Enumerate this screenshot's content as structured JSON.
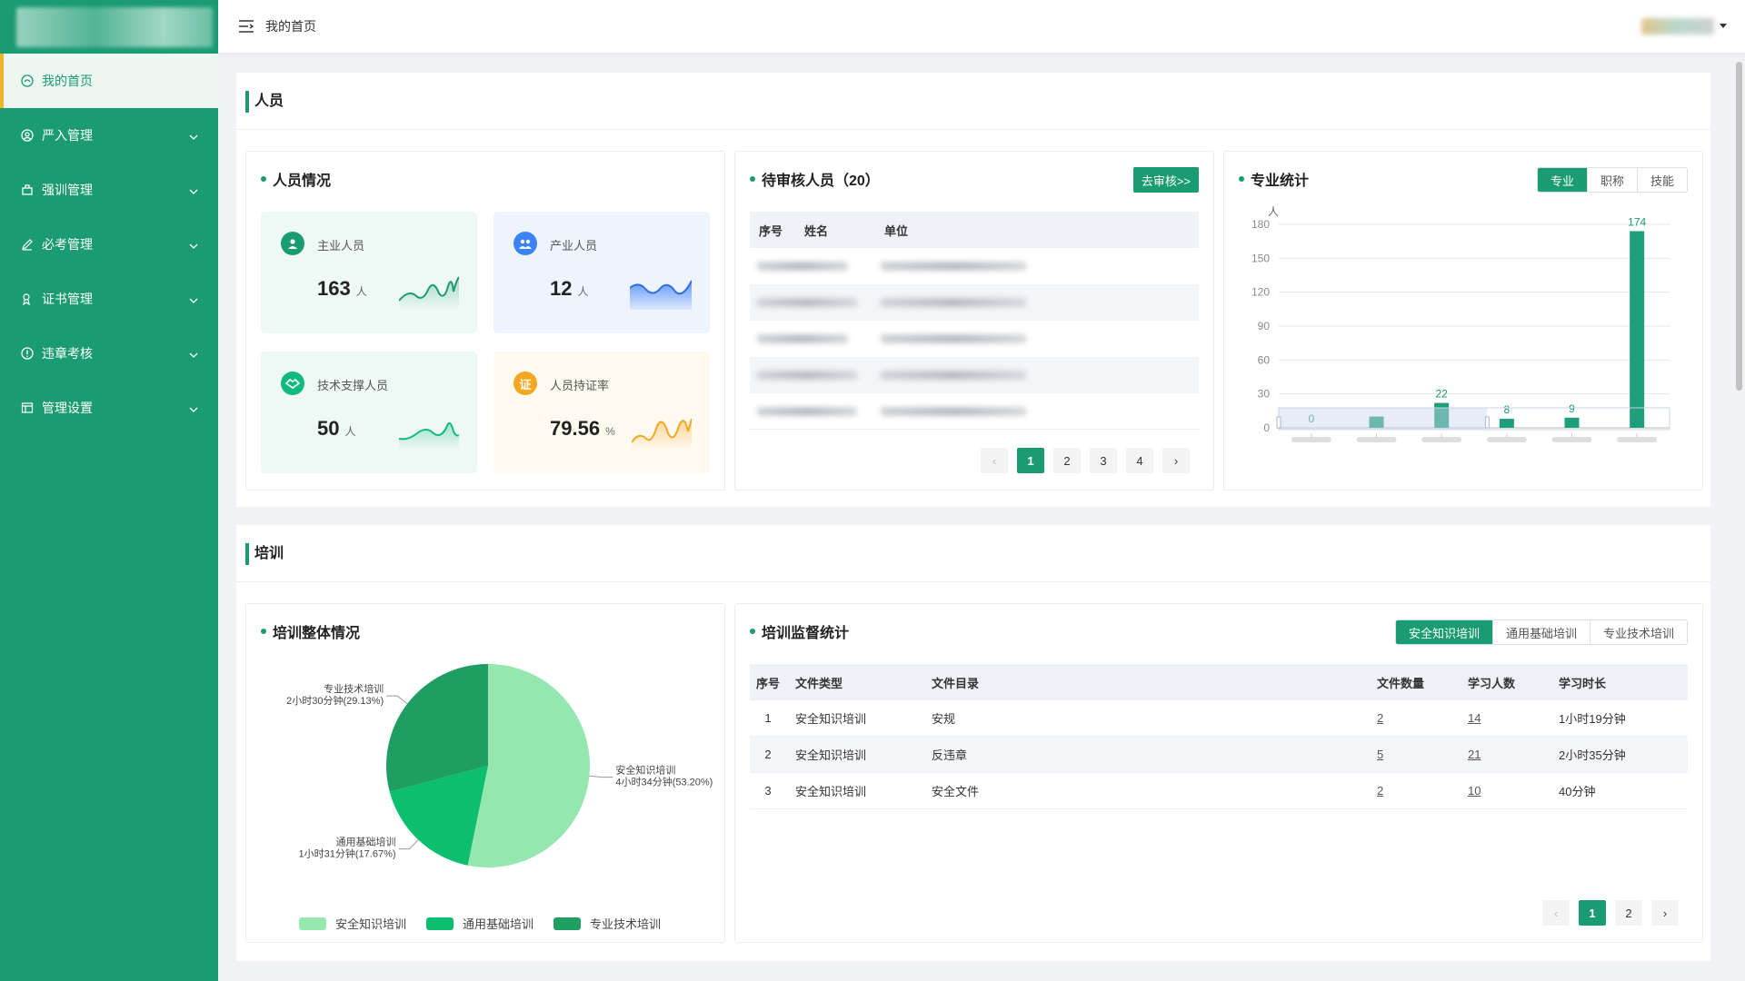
{
  "header": {
    "breadcrumb": "我的首页"
  },
  "sidebar": {
    "items": [
      {
        "label": "我的首页",
        "icon": "home-icon"
      },
      {
        "label": "严入管理",
        "icon": "user-circle-icon"
      },
      {
        "label": "强训管理",
        "icon": "training-icon"
      },
      {
        "label": "必考管理",
        "icon": "pencil-icon"
      },
      {
        "label": "证书管理",
        "icon": "certificate-icon"
      },
      {
        "label": "违章考核",
        "icon": "warning-icon"
      },
      {
        "label": "管理设置",
        "icon": "settings-icon"
      }
    ]
  },
  "personnel": {
    "section_title": "人员",
    "overview": {
      "title": "人员情况",
      "stats": [
        {
          "label": "主业人员",
          "value": "163",
          "unit": "人",
          "color": "#1a9b72"
        },
        {
          "label": "产业人员",
          "value": "12",
          "unit": "人",
          "color": "#3b82f6"
        },
        {
          "label": "技术支撑人员",
          "value": "50",
          "unit": "人",
          "color": "#10b981"
        },
        {
          "label": "人员持证率",
          "value": "79.56",
          "unit": "%",
          "color": "#f5a623"
        }
      ]
    },
    "pending": {
      "title": "待审核人员（20）",
      "button": "去审核>>",
      "columns": [
        "序号",
        "姓名",
        "单位"
      ],
      "pages": [
        "1",
        "2",
        "3",
        "4"
      ],
      "current_page": "1"
    },
    "major": {
      "title": "专业统计",
      "tabs": [
        "专业",
        "职称",
        "技能"
      ],
      "active_tab": "专业"
    }
  },
  "training": {
    "section_title": "培训",
    "overall": {
      "title": "培训整体情况",
      "slices": [
        {
          "name": "安全知识培训",
          "label": "4小时34分钟(53.20%)",
          "percent": 53.2,
          "color": "#96e6b0"
        },
        {
          "name": "通用基础培训",
          "label": "1小时31分钟(17.67%)",
          "percent": 17.67,
          "color": "#0cbf6e"
        },
        {
          "name": "专业技术培训",
          "label": "2小时30分钟(29.13%)",
          "percent": 29.13,
          "color": "#1f9e64"
        }
      ]
    },
    "supervision": {
      "title": "培训监督统计",
      "tabs": [
        "安全知识培训",
        "通用基础培训",
        "专业技术培训"
      ],
      "active_tab": "安全知识培训",
      "columns": [
        "序号",
        "文件类型",
        "文件目录",
        "文件数量",
        "学习人数",
        "学习时长"
      ],
      "rows": [
        {
          "idx": "1",
          "type": "安全知识培训",
          "dir": "安规",
          "count": "2",
          "learners": "14",
          "duration": "1小时19分钟"
        },
        {
          "idx": "2",
          "type": "安全知识培训",
          "dir": "反违章",
          "count": "5",
          "learners": "21",
          "duration": "2小时35分钟"
        },
        {
          "idx": "3",
          "type": "安全知识培训",
          "dir": "安全文件",
          "count": "2",
          "learners": "10",
          "duration": "40分钟"
        }
      ],
      "pages": [
        "1",
        "2"
      ],
      "current_page": "1"
    }
  },
  "chart_data": [
    {
      "type": "bar",
      "title": "专业统计",
      "ylabel": "人",
      "ylim": [
        0,
        180
      ],
      "yticks": [
        0,
        30,
        60,
        90,
        120,
        150,
        180
      ],
      "grid": true,
      "series": [
        {
          "values": [
            0,
            10,
            22,
            8,
            9,
            174
          ]
        }
      ],
      "data_labels": [
        "0",
        "",
        "22",
        "8",
        "9",
        "174"
      ],
      "color": "#1f9e7a"
    },
    {
      "type": "pie",
      "title": "培训整体情况",
      "slices": [
        {
          "name": "安全知识培训",
          "value": 53.2
        },
        {
          "name": "通用基础培训",
          "value": 17.67
        },
        {
          "name": "专业技术培训",
          "value": 29.13
        }
      ],
      "legend": "bottom"
    }
  ]
}
